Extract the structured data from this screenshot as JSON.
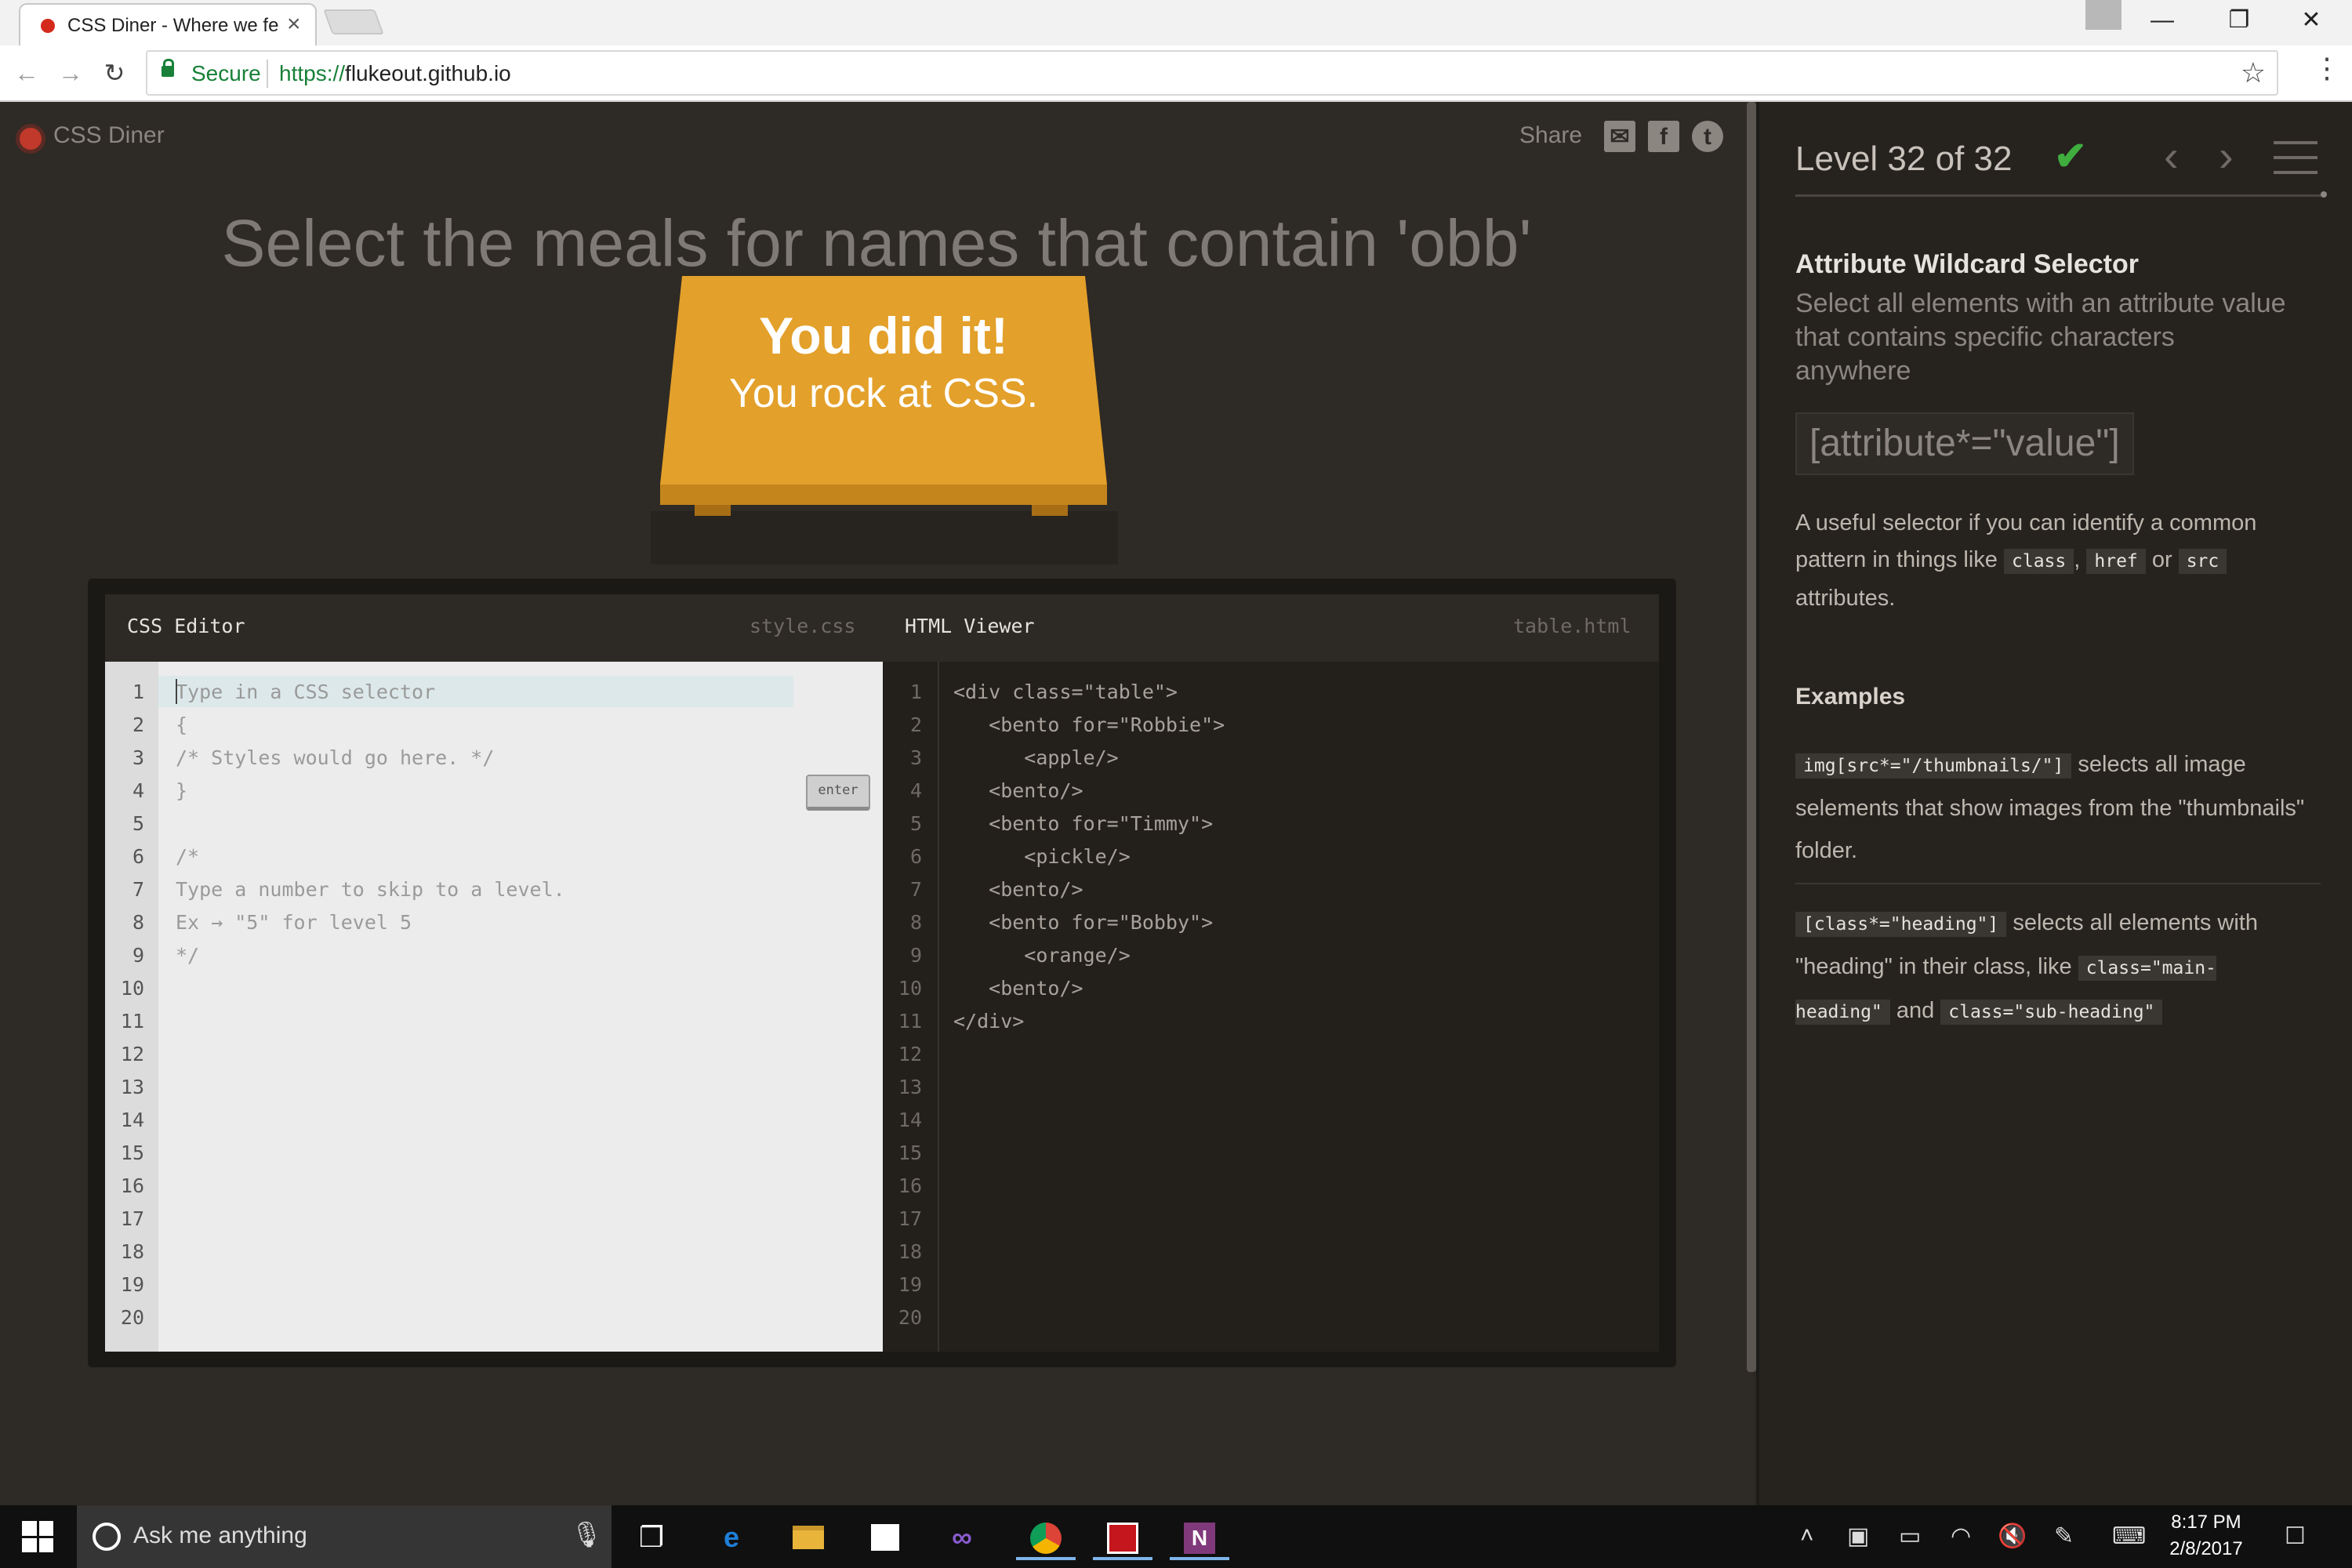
{
  "browser": {
    "tab_title": "CSS Diner - Where we fe",
    "tab_close": "×",
    "window_buttons": [
      "—",
      "❐",
      "✕"
    ],
    "nav": {
      "back": "←",
      "forward": "→",
      "reload": "↻"
    },
    "secure_label": "Secure",
    "url_scheme": "https://",
    "url_host": "flukeout.github.io",
    "star": "☆",
    "menu": "⋮"
  },
  "header": {
    "logo_text": "CSS Diner",
    "share_label": "Share",
    "share_icons": [
      "mail-icon",
      "facebook-icon",
      "twitter-icon"
    ]
  },
  "level": {
    "instruction": "Select the meals for names that contain 'obb'",
    "win_line1": "You did it!",
    "win_line2": "You rock at CSS."
  },
  "editor": {
    "css_title": "CSS Editor",
    "css_file": "style.css",
    "html_title": "HTML Viewer",
    "html_file": "table.html",
    "enter_label": "enter",
    "css_placeholder": "Type in a CSS selector",
    "css_lines": "\n{\n/* Styles would go here. */\n}\n\n/*\nType a number to skip to a level.\nEx → \"5\" for level 5\n*/",
    "html_lines": "<div class=\"table\">\n   <bento for=\"Robbie\">\n      <apple/>\n   <bento/>\n   <bento for=\"Timmy\">\n      <pickle/>\n   <bento/>\n   <bento for=\"Bobby\">\n      <orange/>\n   <bento/>\n</div>",
    "line_numbers": "1\n2\n3\n4\n5\n6\n7\n8\n9\n10\n11\n12\n13\n14\n15\n16\n17\n18\n19\n20"
  },
  "sidebar": {
    "level_indicator": "Level 32 of 32",
    "check": "✔",
    "prev": "‹",
    "next": "›",
    "selector_name": "Attribute Wildcard Selector",
    "selector_title": "Select all elements with an attribute value that contains specific characters anywhere",
    "syntax": "[attribute*=\"value\"]",
    "hint_before": "A useful selector if you can identify a common pattern in things like",
    "hint_kw1": "class",
    "hint_sep": ",",
    "hint_kw2": "href",
    "hint_or": "or",
    "hint_kw3": "src",
    "hint_after": "attributes.",
    "examples_title": "Examples",
    "example1_code": "img[src*=\"/thumbnails/\"]",
    "example1_text": "selects all image selements that show images from the \"thumbnails\" folder.",
    "example2_code": "[class*=\"heading\"]",
    "example2_text": "selects all elements with \"heading\" in their class, like",
    "example2_code2": "class=\"main-heading\"",
    "example2_and": "and",
    "example2_code3": "class=\"sub-heading\""
  },
  "taskbar": {
    "search_placeholder": "Ask me anything",
    "time": "8:17 PM",
    "date": "2/8/2017",
    "apps": [
      "task-view-icon",
      "edge-icon",
      "file-explorer-icon",
      "store-icon",
      "visual-studio-icon",
      "chrome-icon",
      "acrobat-icon",
      "onenote-icon"
    ],
    "tray": [
      "chevron-up-icon",
      "network-display-icon",
      "battery-icon",
      "wifi-icon",
      "mute-icon",
      "pen-icon",
      "keyboard-icon",
      "notification-icon"
    ]
  }
}
